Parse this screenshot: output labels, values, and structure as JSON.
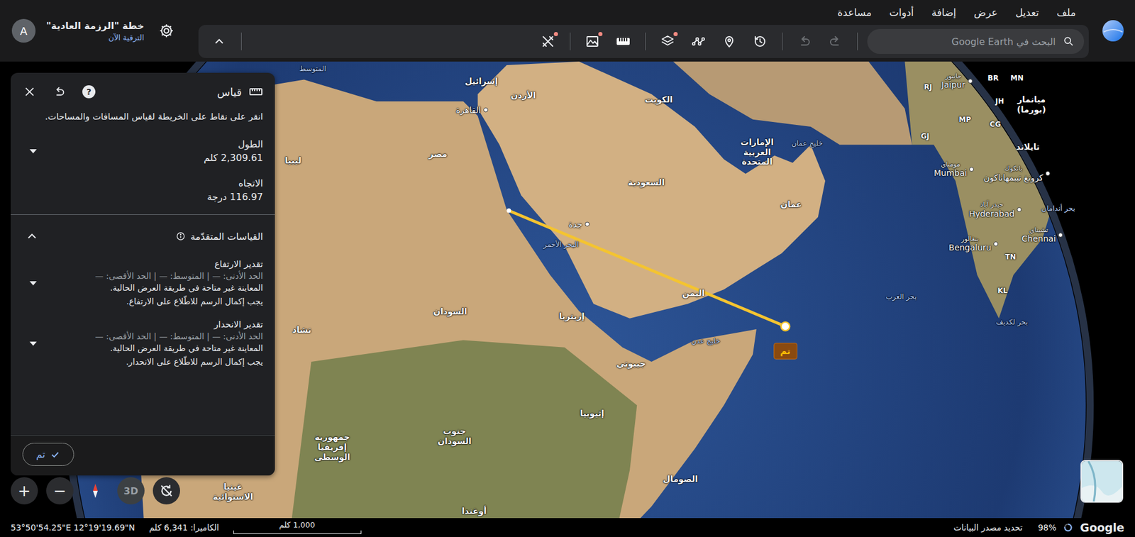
{
  "menu": [
    "ملف",
    "تعديل",
    "عرض",
    "إضافة",
    "أدوات",
    "مساعدة"
  ],
  "search": {
    "placeholder": "البحث في Google Earth"
  },
  "toolbar": [
    [
      {
        "kind": "redo",
        "disabled": true,
        "badge": false,
        "selected": false
      },
      {
        "kind": "undo",
        "disabled": true,
        "badge": false,
        "selected": false
      }
    ],
    [
      {
        "kind": "history",
        "disabled": false,
        "badge": false,
        "selected": false
      },
      {
        "kind": "pin",
        "disabled": false,
        "badge": false,
        "selected": false
      },
      {
        "kind": "path",
        "disabled": false,
        "badge": false,
        "selected": false
      },
      {
        "kind": "layers",
        "disabled": false,
        "badge": true,
        "selected": false
      }
    ],
    [
      {
        "kind": "ruler",
        "disabled": false,
        "badge": false,
        "selected": true
      },
      {
        "kind": "terrain",
        "disabled": false,
        "badge": true,
        "selected": false
      }
    ],
    [
      {
        "kind": "tools",
        "disabled": false,
        "badge": true,
        "selected": false
      }
    ]
  ],
  "plan": {
    "title": "خطة \"الرزمة العادية\"",
    "link": "الترقية الآن"
  },
  "user": {
    "initial": "A"
  },
  "measure_panel": {
    "title": "قياس",
    "help": "?",
    "instructions": "انقر على نقاط على الخريطة لقياس المسافات والمساحات.",
    "metrics": [
      {
        "label": "الطول",
        "value": "2,309.61 كلم",
        "kind": "dropdown",
        "expanded": false
      },
      {
        "label": "الاتجاه",
        "value": "116.97 درجة",
        "kind": "plain",
        "expanded": false
      }
    ],
    "advanced": {
      "title": "القياسات المتقدّمة",
      "expanded": true,
      "sections": [
        {
          "title": "تقدير الارتفاع",
          "stats": "الحد الأدنى: — | المتوسط: — | الحد الأقصى: —",
          "lines": [
            "المعاينة غير متاحة في طريقة العرض الحالية.",
            "يجب إكمال الرسم للاطّلاع على الارتفاع."
          ],
          "expanded": false
        },
        {
          "title": "تقدير الانحدار",
          "stats": "الحد الأدنى: — | المتوسط: — | الحد الأقصى: —",
          "lines": [
            "المعاينة غير متاحة في طريقة العرض الحالية.",
            "يجب إكمال الرسم للاطّلاع على الانحدار."
          ],
          "expanded": false
        }
      ]
    },
    "done": "تم"
  },
  "map": {
    "labels": [
      {
        "text": "إسرائيل",
        "kind": "country"
      },
      {
        "text": "الأردن",
        "kind": "country"
      },
      {
        "text": "القاهرة",
        "kind": "city"
      },
      {
        "text": "الكويت",
        "kind": "country"
      },
      {
        "text": "ليبيا",
        "kind": "country"
      },
      {
        "text": "مصر",
        "kind": "country"
      },
      {
        "text": "السعودية",
        "kind": "country"
      },
      {
        "text": "الإمارات العربية المتحدة",
        "kind": "country"
      },
      {
        "text": "خليج عمان",
        "kind": "water"
      },
      {
        "text": "عمان",
        "kind": "country"
      },
      {
        "text": "جدة",
        "kind": "city"
      },
      {
        "text": "البحر الأحمر",
        "kind": "water"
      },
      {
        "text": "اليمن",
        "kind": "country"
      },
      {
        "text": "السودان",
        "kind": "country"
      },
      {
        "text": "إريتريا",
        "kind": "country"
      },
      {
        "text": "تشاد",
        "kind": "country"
      },
      {
        "text": "خليج عدن",
        "kind": "water"
      },
      {
        "text": "جيبوتي",
        "kind": "country"
      },
      {
        "text": "إثيوبيا",
        "kind": "country"
      },
      {
        "text": "جنوب السودان",
        "kind": "country"
      },
      {
        "text": "جمهورية إفريقيا الوسطى",
        "kind": "country"
      },
      {
        "text": "الصومال",
        "kind": "country"
      },
      {
        "text": "أوغندا",
        "kind": "country"
      },
      {
        "text": "بحر العرب",
        "kind": "water"
      },
      {
        "text": "بحر لكديف",
        "kind": "water"
      },
      {
        "text": "Jaipur",
        "sub": "جايبور",
        "kind": "city"
      },
      {
        "text": "Mumbai",
        "sub": "مومباي",
        "kind": "city"
      },
      {
        "text": "Hyderabad",
        "sub": "حيدر آباد",
        "kind": "city"
      },
      {
        "text": "Bengaluru",
        "sub": "بنغالور",
        "kind": "city"
      },
      {
        "text": "Chennai",
        "sub": "تشيناي",
        "kind": "city"
      },
      {
        "text": "كرونغ تيبمهاناكون",
        "sub": "بانكوك",
        "kind": "city"
      },
      {
        "text": "تايلاند",
        "kind": "country"
      },
      {
        "text": "ميانمار (بورما)",
        "kind": "country"
      },
      {
        "text": "بحر أندامان",
        "kind": "water"
      },
      {
        "text": "RJ",
        "kind": "region"
      },
      {
        "text": "MP",
        "kind": "region"
      },
      {
        "text": "GJ",
        "kind": "region"
      },
      {
        "text": "JH",
        "kind": "region"
      },
      {
        "text": "CG",
        "kind": "region"
      },
      {
        "text": "BR",
        "kind": "region"
      },
      {
        "text": "MN",
        "kind": "region"
      },
      {
        "text": "TN",
        "kind": "region"
      },
      {
        "text": "KL",
        "kind": "region"
      },
      {
        "text": "المتوسط",
        "kind": "water"
      },
      {
        "text": "غينيا الاستوائية",
        "kind": "country"
      }
    ],
    "measurement": {
      "badge": "تم"
    }
  },
  "map_controls": {
    "zoom_in": "+",
    "zoom_out": "−",
    "mode": "3D"
  },
  "status_bar": {
    "coordinates": "53°50'54.25\"E 12°19'19.69\"N",
    "camera": "الكاميرا: 6,341 كلم",
    "scale": "1,000 كلم",
    "attribution": "تحديد مصدر البيانات",
    "loaded": "98%",
    "brand": "Google"
  }
}
